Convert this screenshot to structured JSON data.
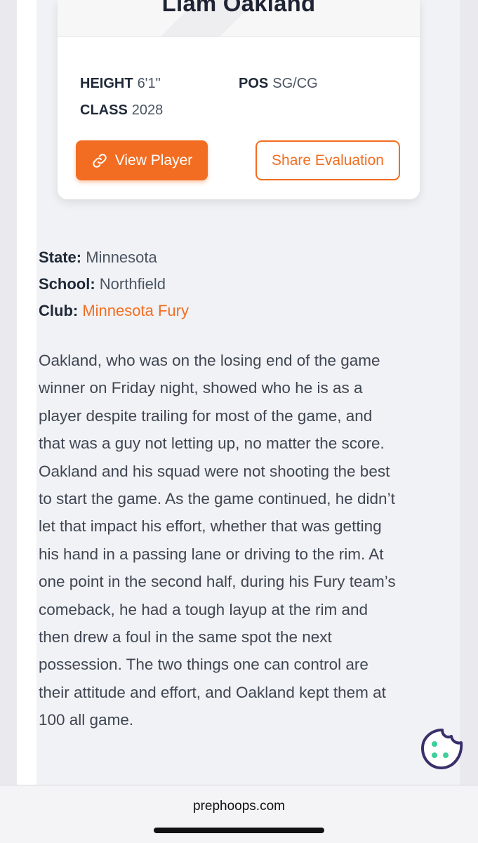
{
  "player": {
    "name": "Liam Oakland",
    "height_label": "HEIGHT",
    "height": "6'1\"",
    "pos_label": "POS",
    "pos": "SG/CG",
    "class_label": "CLASS",
    "class": "2028"
  },
  "buttons": {
    "view_player": "View Player",
    "share_evaluation": "Share Evaluation"
  },
  "details": {
    "state_label": "State:",
    "state": "Minnesota",
    "school_label": "School:",
    "school": "Northfield",
    "club_label": "Club:",
    "club": "Minnesota Fury"
  },
  "evaluation": "Oakland, who was on the losing end of the game winner on Friday night, showed who he is as a player despite trailing for most of the game, and that was a guy not letting up, no matter the score. Oakland and his squad were not shooting the best to start the game. As the game continued, he didn’t let that impact his effort, whether that was getting his hand in a passing lane or driving to the rim. At one point in the second half, during his Fury team’s comeback, he had a tough layup at the rim and then drew a foul in the same spot the next possession. The two things one can control are their attitude and effort, and Oakland kept them at 100 all game.",
  "browser": {
    "url": "prephoops.com"
  },
  "colors": {
    "accent": "#f26d21",
    "cookie": "#3b2f6b",
    "cookie_dots": "#3ecf9a"
  },
  "icons": {
    "view_player": "link-icon",
    "cookie": "cookie-icon"
  }
}
